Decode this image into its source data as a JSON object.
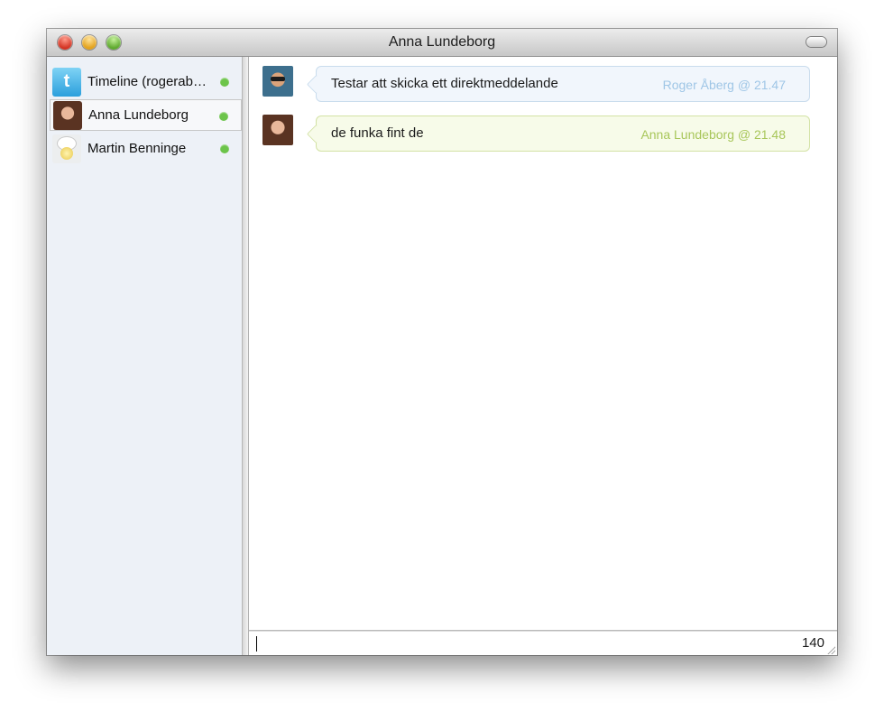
{
  "window": {
    "title": "Anna Lundeborg"
  },
  "sidebar": {
    "items": [
      {
        "label": "Timeline (rogerab…",
        "icon": "twitter-bird-icon",
        "status": "online",
        "selected": false
      },
      {
        "label": "Anna Lundeborg",
        "icon": "avatar",
        "status": "online",
        "selected": true
      },
      {
        "label": "Martin Benninge",
        "icon": "default-avatar-icon",
        "status": "online",
        "selected": false
      }
    ]
  },
  "messages": [
    {
      "text": "Testar att skicka ett direktmeddelande",
      "meta": "Roger Åberg @ 21.47",
      "color": "#9fc6e6"
    },
    {
      "text": "de funka fint de",
      "meta": "Anna Lundeborg @ 21.48",
      "color": "#a8c65a"
    }
  ],
  "compose": {
    "value": "",
    "char_count": "140"
  },
  "colors": {
    "status_online": "#6cc44a",
    "sidebar_bg": "#edf1f7"
  }
}
